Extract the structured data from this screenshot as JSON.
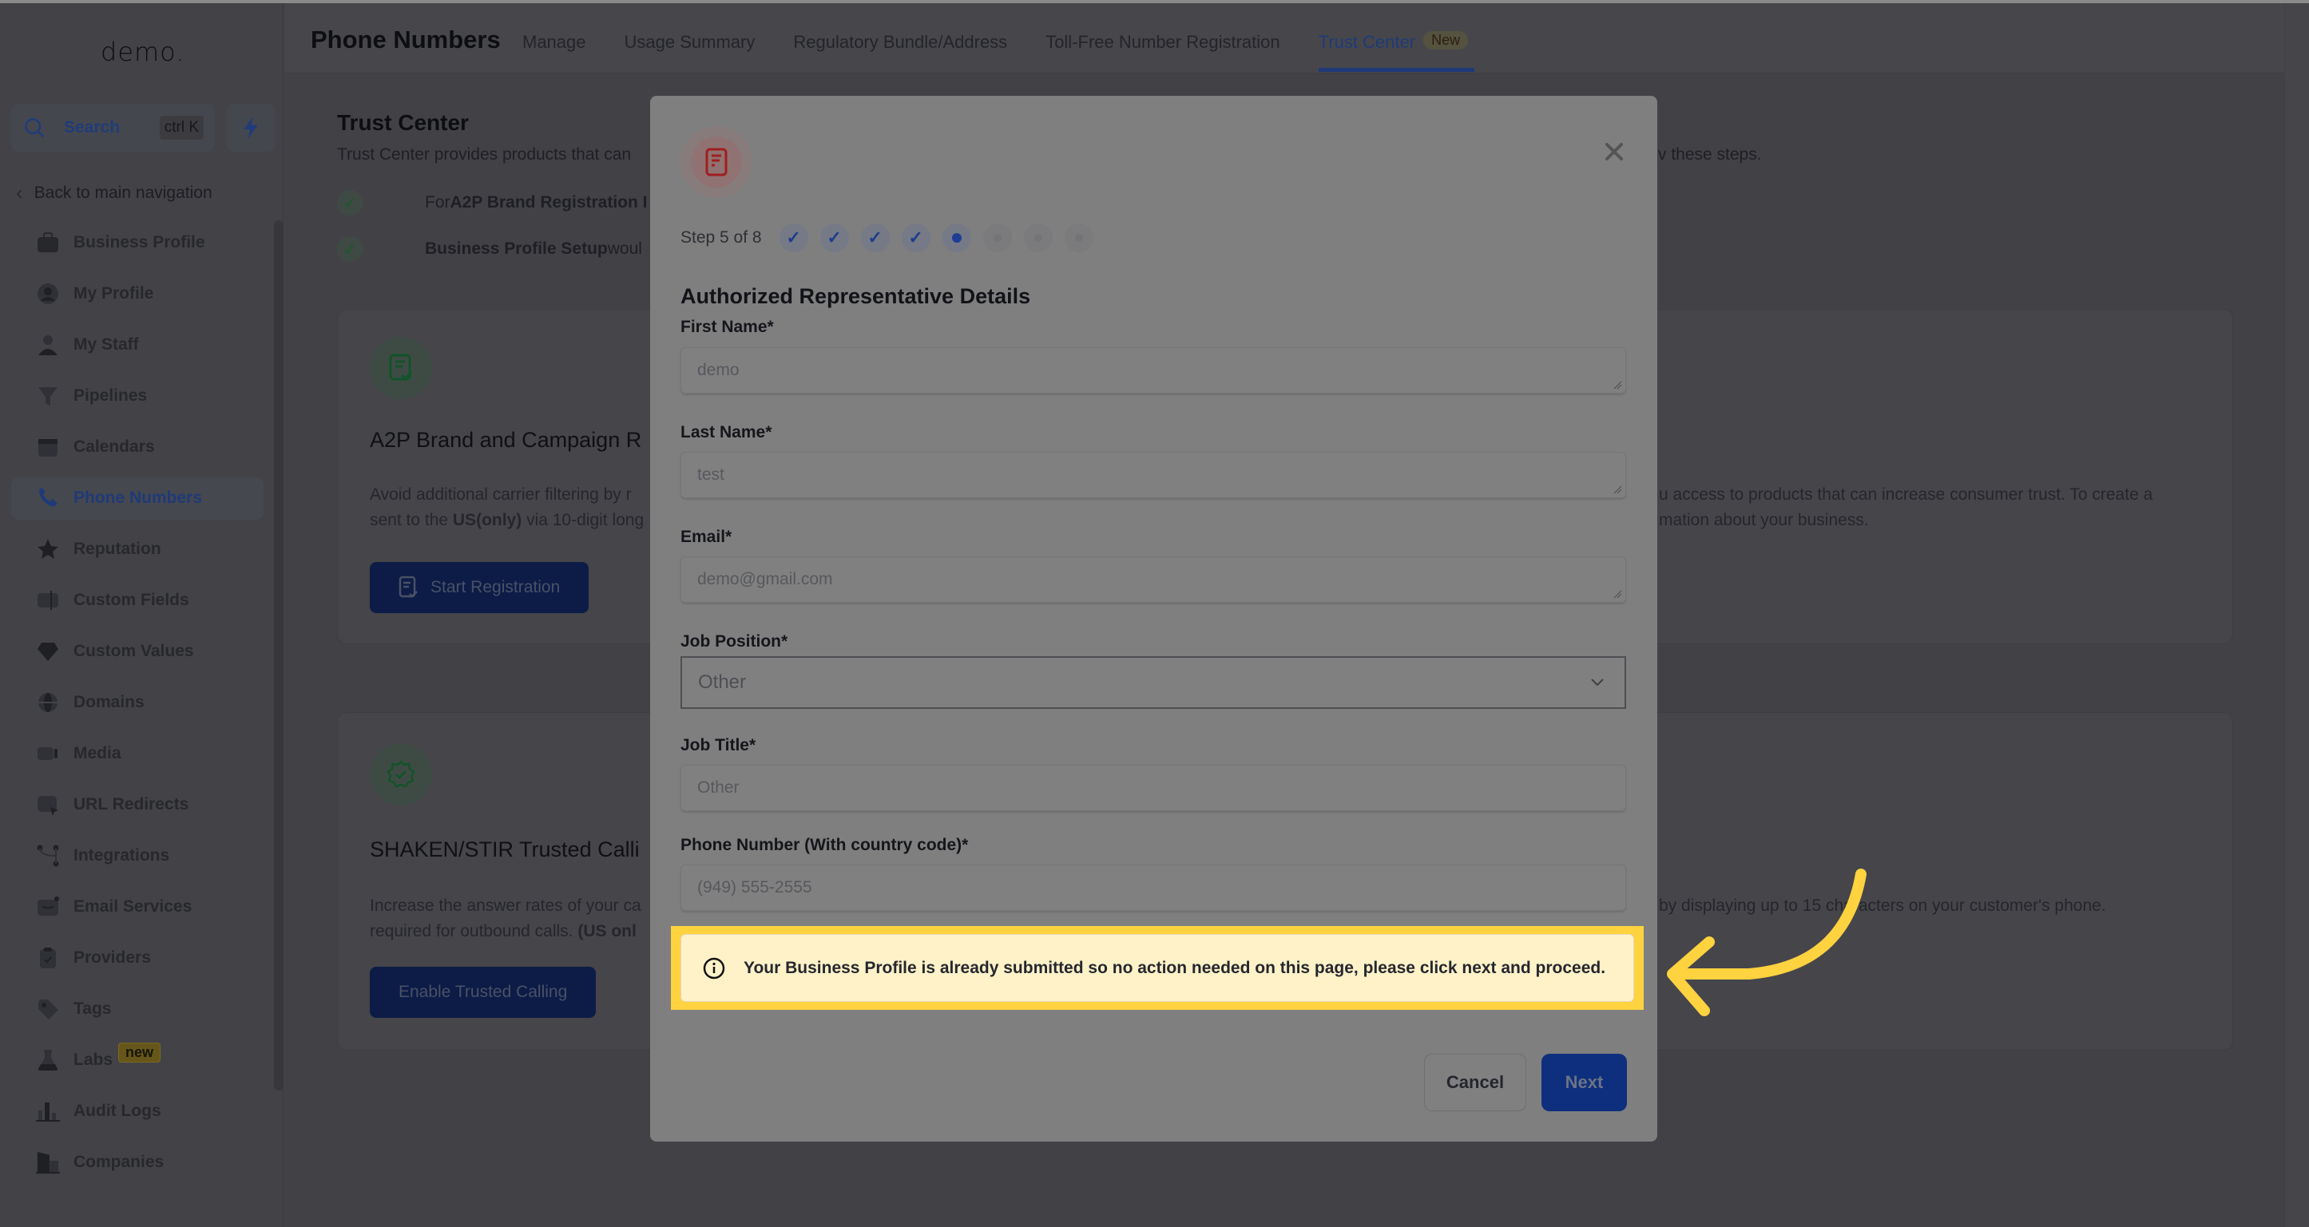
{
  "app": {
    "logo_text": "demo."
  },
  "sidebar": {
    "search_label": "Search",
    "search_shortcut": "ctrl K",
    "back_label": "Back to main navigation",
    "items": [
      {
        "label": "Business Profile",
        "icon": "briefcase-icon"
      },
      {
        "label": "My Profile",
        "icon": "user-circle-icon"
      },
      {
        "label": "My Staff",
        "icon": "user-icon"
      },
      {
        "label": "Pipelines",
        "icon": "funnel-icon"
      },
      {
        "label": "Calendars",
        "icon": "calendar-icon"
      },
      {
        "label": "Phone Numbers",
        "icon": "phone-icon",
        "active": true
      },
      {
        "label": "Reputation",
        "icon": "star-icon"
      },
      {
        "label": "Custom Fields",
        "icon": "text-field-icon"
      },
      {
        "label": "Custom Values",
        "icon": "diamond-icon"
      },
      {
        "label": "Domains",
        "icon": "globe-icon"
      },
      {
        "label": "Media",
        "icon": "video-icon"
      },
      {
        "label": "URL Redirects",
        "icon": "cursor-icon"
      },
      {
        "label": "Integrations",
        "icon": "integration-icon"
      },
      {
        "label": "Email Services",
        "icon": "mail-icon"
      },
      {
        "label": "Providers",
        "icon": "clipboard-check-icon"
      },
      {
        "label": "Tags",
        "icon": "tag-icon"
      },
      {
        "label": "Labs",
        "icon": "flask-icon",
        "badge": "new"
      },
      {
        "label": "Audit Logs",
        "icon": "bar-chart-icon"
      },
      {
        "label": "Companies",
        "icon": "building-icon"
      }
    ]
  },
  "header": {
    "title": "Phone Numbers",
    "tabs": [
      {
        "label": "Manage"
      },
      {
        "label": "Usage Summary"
      },
      {
        "label": "Regulatory Bundle/Address"
      },
      {
        "label": "Toll-Free Number Registration"
      },
      {
        "label": "Trust Center",
        "badge": "New",
        "active": true
      }
    ]
  },
  "page": {
    "title": "Trust Center",
    "description_left": "Trust Center provides products that can",
    "description_right": "v these steps.",
    "checks": [
      {
        "prefix": "For ",
        "bold": "A2P Brand Registration I",
        "rest": ""
      },
      {
        "prefix": "",
        "bold": "Business Profile Setup",
        "rest": " woul"
      }
    ],
    "cards": [
      {
        "title": "A2P Brand and Campaign R",
        "desc_line1": "Avoid additional carrier filtering by r",
        "desc_line2_prefix": "sent to the ",
        "desc_line2_bold": "US(only)",
        "desc_line2_rest": " via 10-digit long",
        "desc_right_line1": "u access to products that can increase consumer trust. To create a",
        "desc_right_line2": "mation about your business.",
        "button": "Start Registration"
      },
      {
        "title": "SHAKEN/STIR Trusted Calli",
        "desc_line1": "Increase the answer rates of your ca",
        "desc_line2_prefix": "required for outbound calls. ",
        "desc_line2_bold": "(US onl",
        "desc_line2_rest": "",
        "desc_right_line1": "by displaying up to 15 characters on your customer's phone.",
        "button": "Enable Trusted Calling"
      }
    ]
  },
  "modal": {
    "step_label": "Step 5 of 8",
    "current_step": 5,
    "total_steps": 8,
    "title": "Authorized Representative Details",
    "fields": [
      {
        "label": "First Name*",
        "value": "demo"
      },
      {
        "label": "Last Name*",
        "value": "test"
      },
      {
        "label": "Email*",
        "value": "demo@gmail.com"
      },
      {
        "label": "Job Position*",
        "value": "Other",
        "type": "select"
      },
      {
        "label": "Job Title*",
        "value": "Other"
      },
      {
        "label": "Phone Number (With country code)*",
        "value": "(949) 555-2555"
      }
    ],
    "alert": "Your Business Profile is already submitted so no action needed on this page, please click next and proceed.",
    "cancel_label": "Cancel",
    "next_label": "Next"
  },
  "colors": {
    "highlight": "#ffd23f",
    "primary": "#0d2f7d",
    "alert_bg": "#fff2c8"
  }
}
